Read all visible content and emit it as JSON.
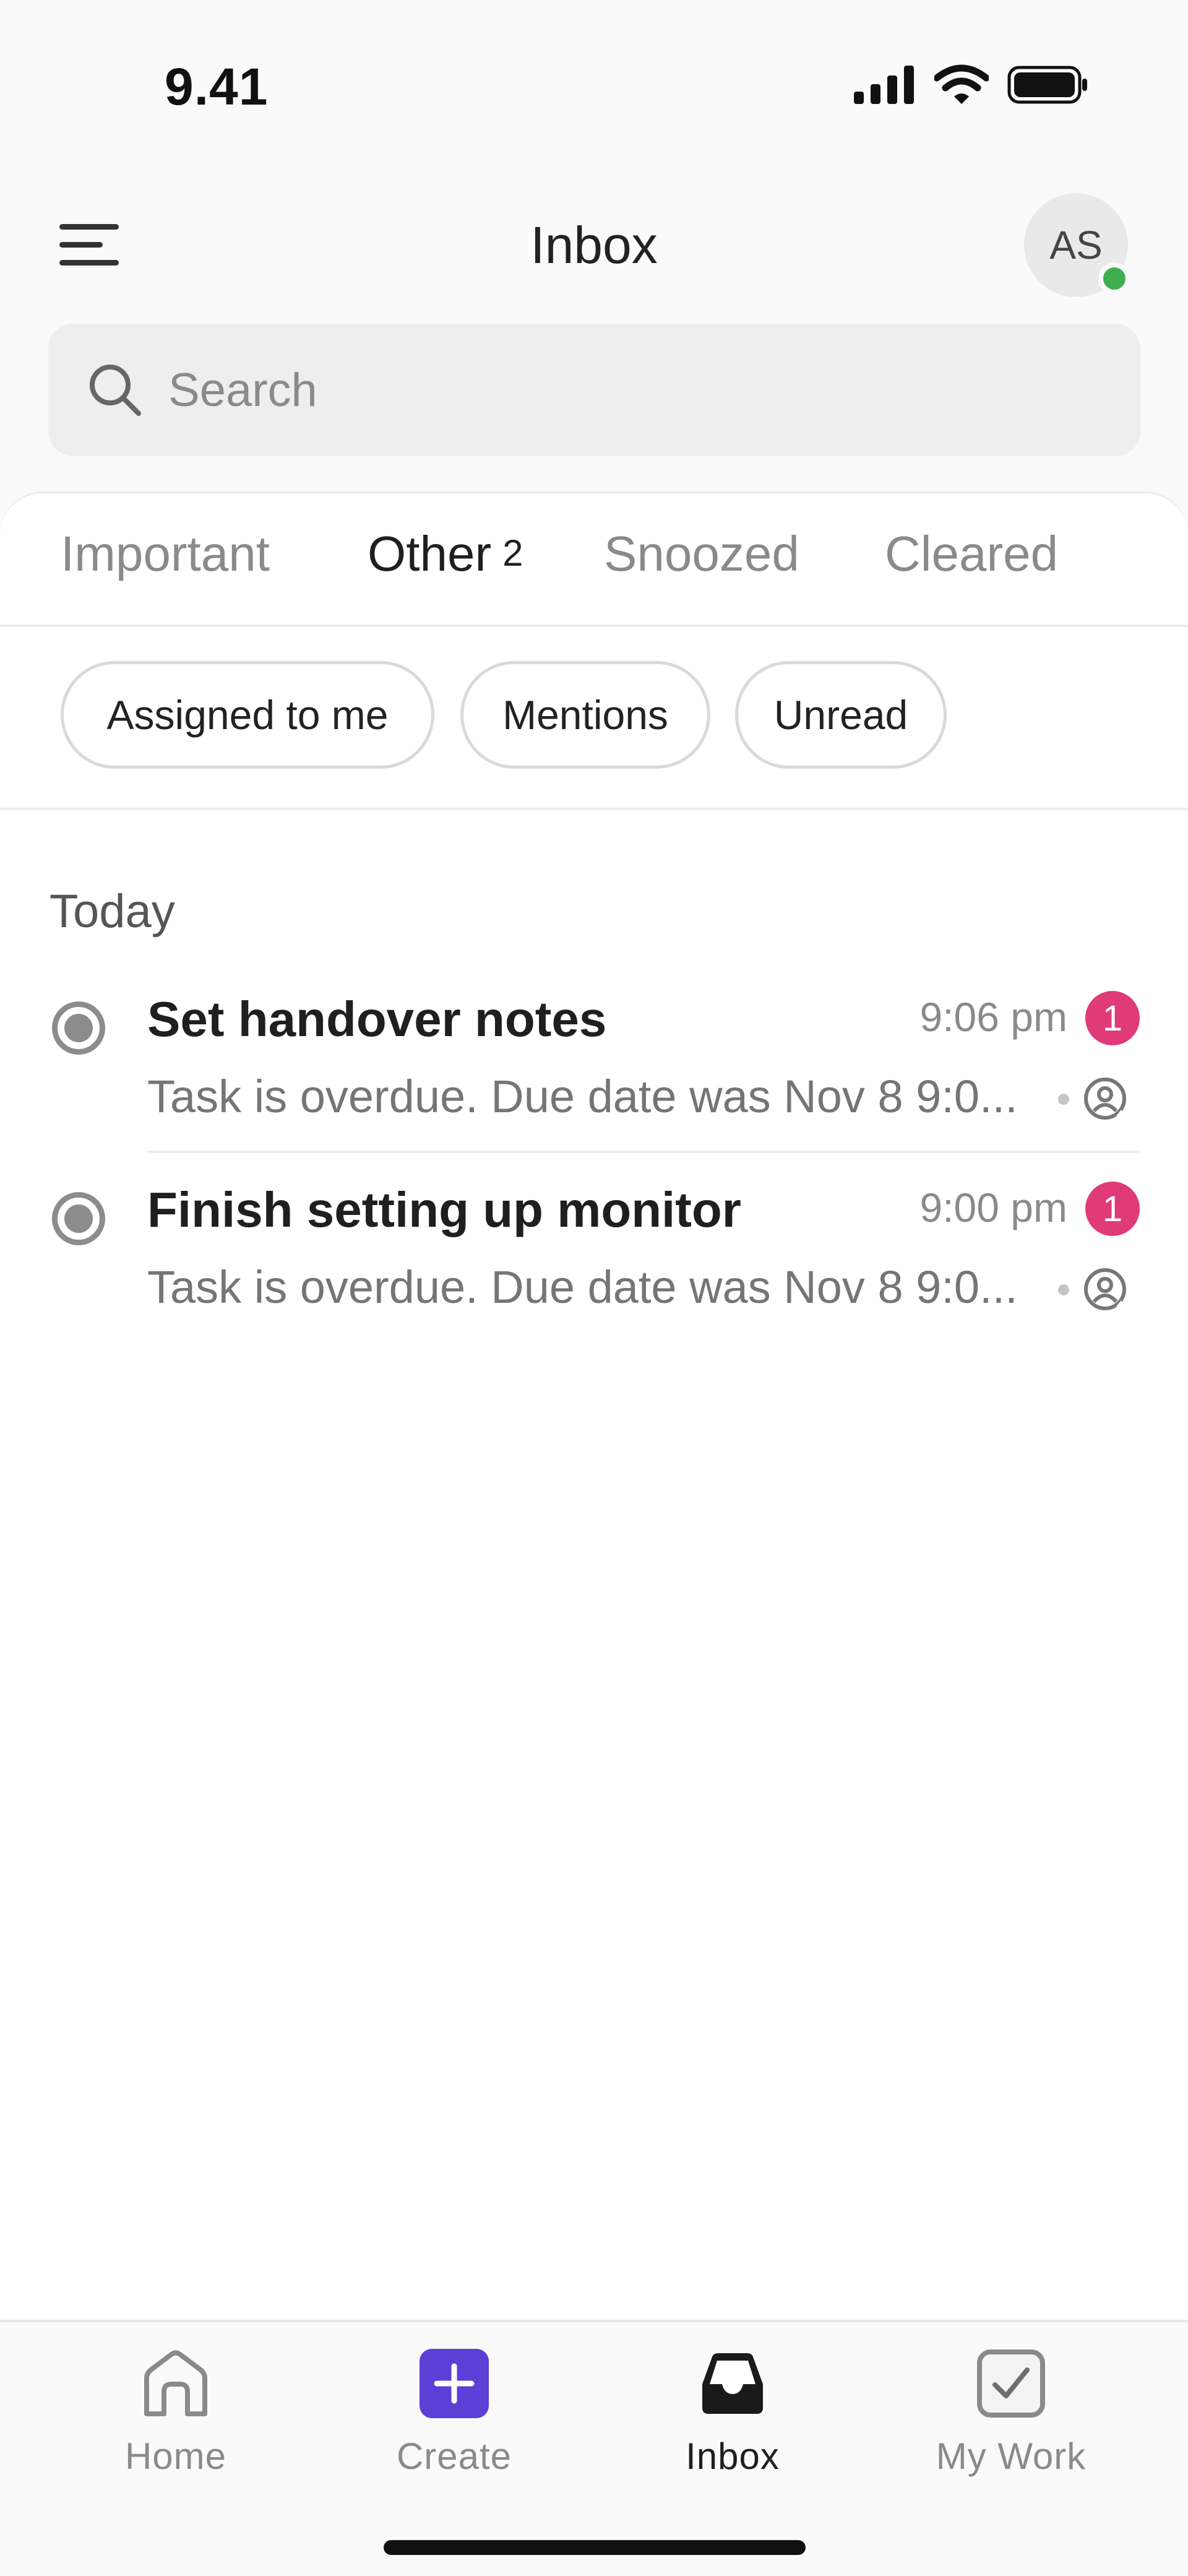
{
  "status_bar": {
    "time": "9.41",
    "icons": [
      "signal-icon",
      "wifi-icon",
      "battery-icon"
    ]
  },
  "header": {
    "title": "Inbox",
    "avatar_initials": "AS",
    "menu_icon": "menu-icon"
  },
  "search": {
    "placeholder": "Search",
    "value": ""
  },
  "tabs": [
    {
      "label": "Important",
      "count": "",
      "active": false
    },
    {
      "label": "Other",
      "count": "2",
      "active": true
    },
    {
      "label": "Snoozed",
      "count": "",
      "active": false
    },
    {
      "label": "Cleared",
      "count": "",
      "active": false
    }
  ],
  "filters": [
    {
      "label": "Assigned to me"
    },
    {
      "label": "Mentions"
    },
    {
      "label": "Unread"
    }
  ],
  "section": {
    "title": "Today"
  },
  "items": [
    {
      "title": "Set handover notes",
      "time": "9:06 pm",
      "badge": "1",
      "subtitle": "Task is overdue. Due date was Nov 8 9:0..."
    },
    {
      "title": "Finish setting up monitor",
      "time": "9:00 pm",
      "badge": "1",
      "subtitle": "Task is overdue. Due date was Nov 8 9:0..."
    }
  ],
  "bottom_nav": [
    {
      "label": "Home",
      "icon": "home-icon",
      "active": false
    },
    {
      "label": "Create",
      "icon": "plus-icon",
      "active": false
    },
    {
      "label": "Inbox",
      "icon": "inbox-icon",
      "active": true
    },
    {
      "label": "My Work",
      "icon": "check-square-icon",
      "active": false
    }
  ],
  "colors": {
    "badge": "#e03a78",
    "presence": "#3fae4f",
    "create_accent": "#5b3fd6",
    "text_primary": "#1f1f1f",
    "text_muted": "#8a8a8a"
  }
}
